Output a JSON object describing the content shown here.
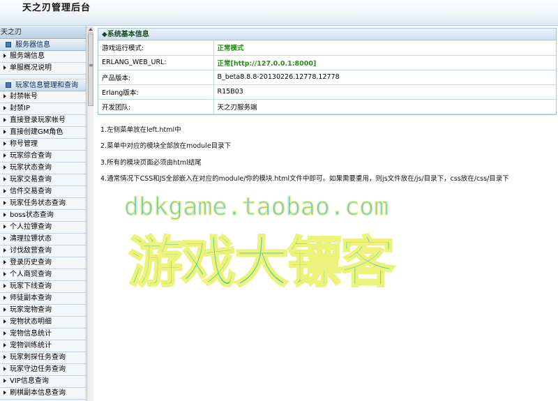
{
  "header": {
    "title": "天之刃管理后台"
  },
  "sidebar": {
    "top_label": "天之刃",
    "sections": [
      {
        "title": "服务器信息",
        "items": [
          "服务端信息",
          "单服概况说明"
        ]
      },
      {
        "title": "玩家信息管理和查询",
        "items": [
          "封禁帐号",
          "封禁IP",
          "直接登录玩家帐号",
          "直接创建GM角色",
          "称号管理",
          "玩家综合查询",
          "玩家状态查询",
          "玩家交易查询",
          "信件交易查询",
          "玩家任务状态查询",
          "boss状态查询",
          "个人拉镖查询",
          "清理拉镖状态",
          "讨伐敌营查询",
          "登录历史查询",
          "个人商贸查询",
          "玩家下线查询",
          "师徒副本查询",
          "玩家宠物查询",
          "宠物状态明细",
          "宠物信息统计",
          "宠物训练统计",
          "玩家刺探任务查询",
          "玩家守边任务查询",
          "VIP信息查询",
          "刷棋副本信息查询"
        ]
      }
    ]
  },
  "panel": {
    "title": "◆系统基本信息",
    "rows": [
      {
        "label": "游戏运行模式:",
        "value": "正常模式",
        "highlight": true
      },
      {
        "label": "ERLANG_WEB_URL:",
        "value": "正常[http://127.0.0.1:8000]",
        "highlight": true
      },
      {
        "label": "产品版本:",
        "value": "B_beta8.8.8-20130226.12778.12778",
        "highlight": false
      },
      {
        "label": "Erlang版本:",
        "value": "R15B03",
        "highlight": false
      },
      {
        "label": "开发团队:",
        "value": "天之刃服务端",
        "highlight": false
      }
    ]
  },
  "notes": [
    "1.左侧菜单放在left.html中",
    "2.菜单中对应的模块全部放在module目录下",
    "3.所有的模块页面必须由html结尾",
    "4.通常情况下CSS和JS全部嵌入在对应的module/你的模块.html文件中即可。如果需要重用，则js文件放在/js/目录下，css放在/css/目录下"
  ],
  "watermark": {
    "url": "dbkgame.taobao.com",
    "text": "游戏大镖客"
  },
  "colors": {
    "accent": "#2a8a1a",
    "sidebar_bg": "#eef3f8",
    "border": "#a9c3dc"
  },
  "icons": {
    "section": "square-bullet-icon",
    "item": "triangle-bullet-icon"
  }
}
